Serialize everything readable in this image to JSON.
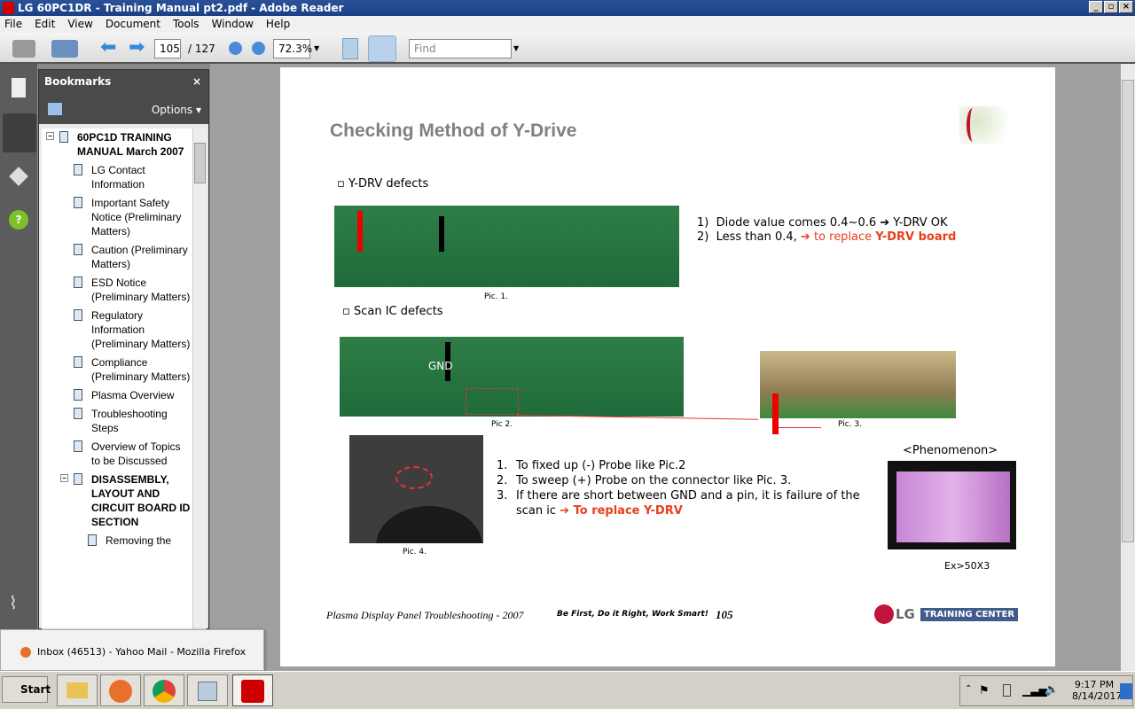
{
  "window": {
    "title": "LG 60PC1DR - Training Manual pt2.pdf - Adobe Reader"
  },
  "menu": [
    "File",
    "Edit",
    "View",
    "Document",
    "Tools",
    "Window",
    "Help"
  ],
  "toolbar": {
    "page_current": "105",
    "page_total": "/ 127",
    "zoom": "72.3%",
    "find_placeholder": "Find"
  },
  "bookmarks": {
    "title": "Bookmarks",
    "options": "Options",
    "items": [
      {
        "label": "60PC1D TRAINING MANUAL March 2007",
        "level": 0
      },
      {
        "label": "LG Contact Information",
        "level": 1
      },
      {
        "label": "Important Safety Notice (Preliminary Matters)",
        "level": 1
      },
      {
        "label": "Caution (Preliminary Matters)",
        "level": 1
      },
      {
        "label": "ESD Notice (Preliminary Matters)",
        "level": 1
      },
      {
        "label": "Regulatory Information (Preliminary Matters)",
        "level": 1
      },
      {
        "label": "Compliance (Preliminary Matters)",
        "level": 1
      },
      {
        "label": "Plasma Overview",
        "level": 1
      },
      {
        "label": "Troubleshooting Steps",
        "level": 1
      },
      {
        "label": "Overview of Topics to be Discussed",
        "level": 1
      },
      {
        "label": "DISASSEMBLY, LAYOUT AND CIRCUIT BOARD ID SECTION",
        "level": 1
      },
      {
        "label": "Removing the",
        "level": 2
      }
    ]
  },
  "page": {
    "title": "Checking Method of Y-Drive",
    "logo_text": "Be First Do It Right Work Smart!",
    "section1": "Y-DRV defects",
    "s1_items": [
      {
        "n": "1)",
        "text": "Diode value comes 0.4~0.6 ➔ Y-DRV OK"
      },
      {
        "n": "2)",
        "text": "Less than 0.4,",
        "red": "➔ to replace ",
        "bold": "Y-DRV board"
      }
    ],
    "pic1": "Pic. 1.",
    "section2": "Scan IC defects",
    "gnd": "GND",
    "pic2": "Pic 2.",
    "pic3": "Pic. 3.",
    "pic4": "Pic. 4.",
    "steps": [
      {
        "n": "1.",
        "text": "To fixed up (-) Probe like Pic.2"
      },
      {
        "n": "2.",
        "text": "To sweep (+) Probe on the connector like Pic. 3."
      },
      {
        "n": "3.",
        "text": "If there are short between GND and a pin, it is failure of the scan ic",
        "red": "➔ To replace Y-DRV"
      }
    ],
    "phenomenon": "<Phenomenon>",
    "example": "Ex>50X3",
    "footer": "Plasma Display Panel Troubleshooting - 2007",
    "footer_slogan": "Be First, Do it Right, Work Smart!",
    "page_number": "105",
    "lg": "LG",
    "training_center": "TRAINING CENTER"
  },
  "tooltip": {
    "text": "Inbox (46513) - Yahoo Mail - Mozilla Firefox"
  },
  "taskbar": {
    "start": "Start",
    "time": "9:17 PM",
    "date": "8/14/2017"
  },
  "colors": {
    "accent_red": "#e8401c",
    "title_gray": "#808080"
  }
}
